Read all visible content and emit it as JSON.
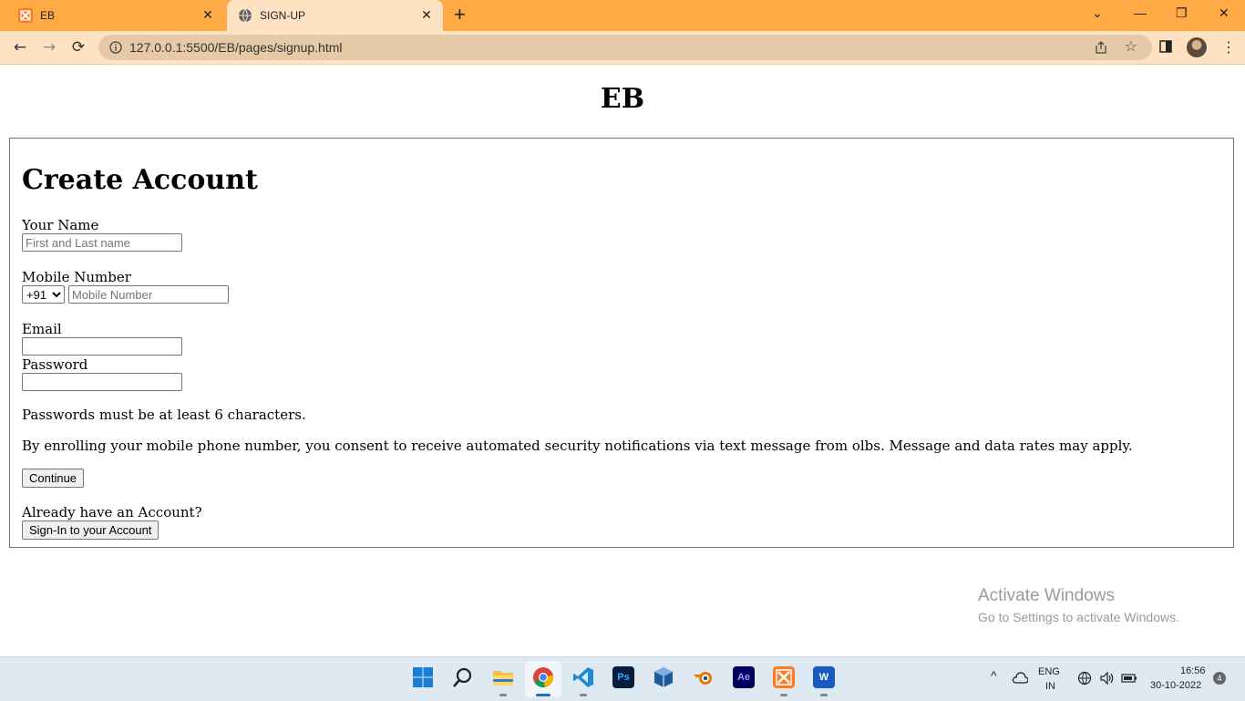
{
  "browser": {
    "tabs": [
      {
        "title": "EB",
        "favicon": "xampp-icon",
        "active": false
      },
      {
        "title": "SIGN-UP",
        "favicon": "globe-icon",
        "active": true
      }
    ],
    "new_tab": "+",
    "window_controls": {
      "tab_search": "⌄",
      "minimize": "—",
      "restore": "❐",
      "close": "✕"
    },
    "nav": {
      "back": "←",
      "forward": "→",
      "reload": "⟳"
    },
    "url": "127.0.0.1:5500/EB/pages/signup.html",
    "star": "☆",
    "menu": "⋮",
    "accent_colors": {
      "tabstrip": "#ffaa44",
      "toolbar": "#ffe2c2",
      "omnibox": "#e6c9a6"
    }
  },
  "page": {
    "brand": "EB",
    "heading": "Create Account",
    "name_label": "Your Name",
    "name_placeholder": "First and Last name",
    "mobile_label": "Mobile Number",
    "country_code": "+91",
    "mobile_placeholder": "Mobile Number",
    "email_label": "Email",
    "password_label": "Password",
    "password_hint": "Passwords must be at least 6 characters.",
    "consent_text": "By enrolling your mobile phone number, you consent to receive automated security notifications via text message from olbs. Message and data rates may apply.",
    "continue_label": "Continue",
    "existing_prompt": "Already have an Account?",
    "signin_label": "Sign-In to your Account"
  },
  "watermark": {
    "line1": "Activate Windows",
    "line2": "Go to Settings to activate Windows."
  },
  "taskbar": {
    "apps": [
      {
        "name": "windows-start-icon"
      },
      {
        "name": "search-icon"
      },
      {
        "name": "file-explorer-icon"
      },
      {
        "name": "chrome-icon"
      },
      {
        "name": "vscode-icon"
      },
      {
        "name": "photoshop-icon",
        "label": "Ps"
      },
      {
        "name": "virtualbox-icon"
      },
      {
        "name": "blender-icon"
      },
      {
        "name": "after-effects-icon",
        "label": "Ae"
      },
      {
        "name": "xampp-icon"
      },
      {
        "name": "word-icon",
        "label": "W"
      }
    ],
    "tray": {
      "chevron": "^",
      "language_line1": "ENG",
      "language_line2": "IN",
      "time": "16:56",
      "date": "30-10-2022",
      "notifications": "4"
    }
  }
}
